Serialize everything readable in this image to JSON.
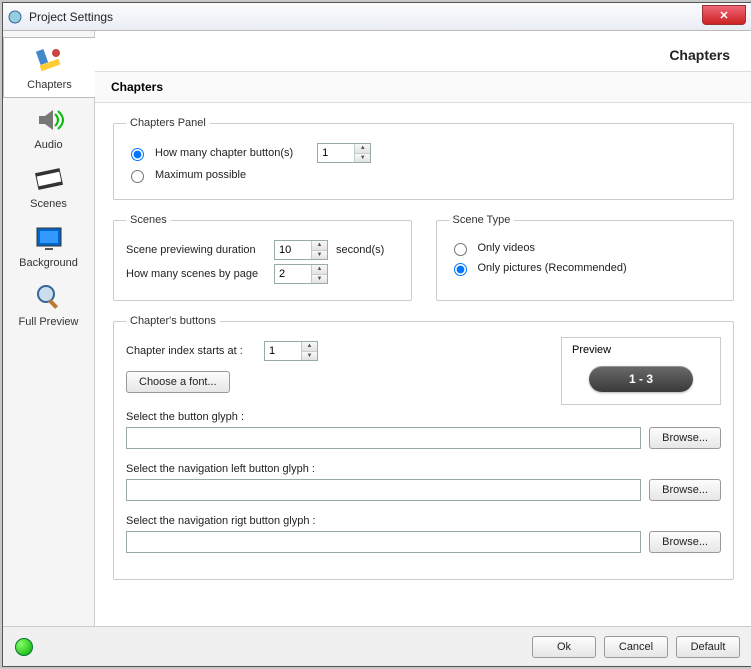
{
  "window": {
    "title": "Project Settings"
  },
  "header": {
    "page": "Chapters",
    "section": "Chapters"
  },
  "sidebar": {
    "items": [
      {
        "label": "Chapters"
      },
      {
        "label": "Audio"
      },
      {
        "label": "Scenes"
      },
      {
        "label": "Background"
      },
      {
        "label": "Full Preview"
      }
    ]
  },
  "chapters_panel": {
    "legend": "Chapters Panel",
    "opt_howmany": "How many  chapter button(s)",
    "howmany_value": "1",
    "opt_max": "Maximum possible"
  },
  "scenes": {
    "legend": "Scenes",
    "preview_label": "Scene previewing duration",
    "preview_value": "10",
    "seconds": "second(s)",
    "bypage_label": "How many scenes by page",
    "bypage_value": "2"
  },
  "scene_type": {
    "legend": "Scene Type",
    "only_videos": "Only videos",
    "only_pictures": "Only pictures (Recommended)"
  },
  "chapter_buttons": {
    "legend": "Chapter's buttons",
    "index_label": "Chapter index starts at :",
    "index_value": "1",
    "font_btn": "Choose a font...",
    "preview_label": "Preview",
    "preview_text": "1 - 3",
    "glyph_label": "Select the button glyph :",
    "nav_left_label": "Select the navigation left button glyph :",
    "nav_right_label": "Select the navigation rigt button glyph :",
    "browse": "Browse...",
    "glyph_value": "",
    "nav_left_value": "",
    "nav_right_value": ""
  },
  "footer": {
    "ok": "Ok",
    "cancel": "Cancel",
    "default": "Default"
  }
}
